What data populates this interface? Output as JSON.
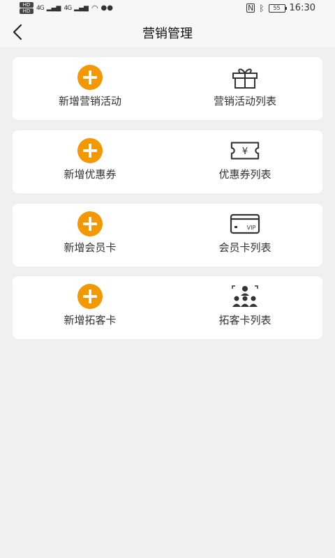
{
  "status_bar": {
    "left_hd1": "HD",
    "left_hd2": "HD",
    "left_signal1": "4G",
    "left_signal2": "4G",
    "battery": "55",
    "time": "16:30"
  },
  "header": {
    "title": "营销管理"
  },
  "colors": {
    "accent_orange": "#f39800",
    "icon_dark": "#333333"
  },
  "cards": [
    {
      "left": {
        "label": "新增营销活动",
        "icon": "plus-circle-icon"
      },
      "right": {
        "label": "营销活动列表",
        "icon": "gift-icon"
      }
    },
    {
      "left": {
        "label": "新增优惠券",
        "icon": "plus-circle-icon"
      },
      "right": {
        "label": "优惠券列表",
        "icon": "coupon-ticket-icon",
        "icon_text": "¥"
      }
    },
    {
      "left": {
        "label": "新增会员卡",
        "icon": "plus-circle-icon"
      },
      "right": {
        "label": "会员卡列表",
        "icon": "vip-card-icon",
        "icon_text": "VIP"
      }
    },
    {
      "left": {
        "label": "新增拓客卡",
        "icon": "plus-circle-icon"
      },
      "right": {
        "label": "拓客卡列表",
        "icon": "people-group-icon"
      }
    }
  ]
}
